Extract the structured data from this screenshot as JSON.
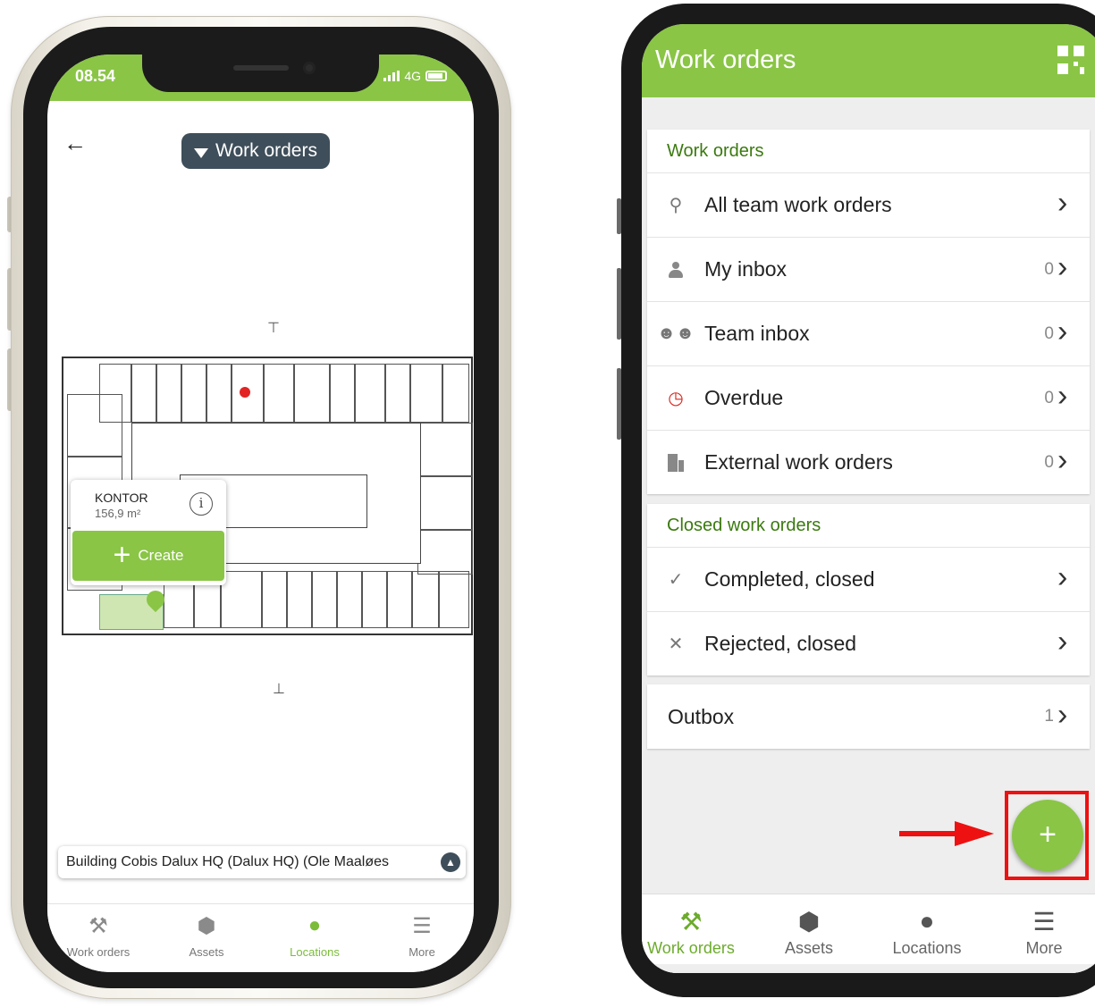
{
  "left_phone": {
    "status": {
      "time": "08.54",
      "network": "4G"
    },
    "header": {
      "back_icon": "arrow-left-icon",
      "filter_label": "Work orders"
    },
    "popup": {
      "room_name": "KONTOR",
      "room_area": "156,9 m²",
      "create_label": "Create"
    },
    "building_label": "Building Cobis Dalux HQ (Dalux HQ) (Ole Maaløes",
    "tabs": [
      {
        "label": "Work orders",
        "icon": "tools-icon"
      },
      {
        "label": "Assets",
        "icon": "cube-icon"
      },
      {
        "label": "Locations",
        "icon": "location-pin-icon",
        "active": true
      },
      {
        "label": "More",
        "icon": "hamburger-menu-icon"
      }
    ]
  },
  "right_phone": {
    "header": {
      "title": "Work orders",
      "qr_icon": "qr-code-icon"
    },
    "work_orders_section": {
      "title": "Work orders",
      "items": [
        {
          "label": "All team work orders",
          "count": "",
          "icon": "search-icon"
        },
        {
          "label": "My inbox",
          "count": "0",
          "icon": "person-icon"
        },
        {
          "label": "Team inbox",
          "count": "0",
          "icon": "team-icon"
        },
        {
          "label": "Overdue",
          "count": "0",
          "icon": "alarm-clock-icon"
        },
        {
          "label": "External work orders",
          "count": "0",
          "icon": "building-icon"
        }
      ]
    },
    "closed_section": {
      "title": "Closed work orders",
      "items": [
        {
          "label": "Completed, closed",
          "icon": "check-icon"
        },
        {
          "label": "Rejected, closed",
          "icon": "x-icon"
        }
      ]
    },
    "outbox": {
      "label": "Outbox",
      "count": "1"
    },
    "fab_label": "+",
    "tabs": [
      {
        "label": "Work orders",
        "icon": "tools-icon",
        "active": true
      },
      {
        "label": "Assets",
        "icon": "cube-icon"
      },
      {
        "label": "Locations",
        "icon": "location-pin-icon"
      },
      {
        "label": "More",
        "icon": "hamburger-menu-icon"
      }
    ]
  },
  "colors": {
    "brand_green": "#8ac546",
    "section_title_green": "#3b7a0f",
    "highlight_red": "#ee1111",
    "filter_pill": "#3e4e5a"
  }
}
